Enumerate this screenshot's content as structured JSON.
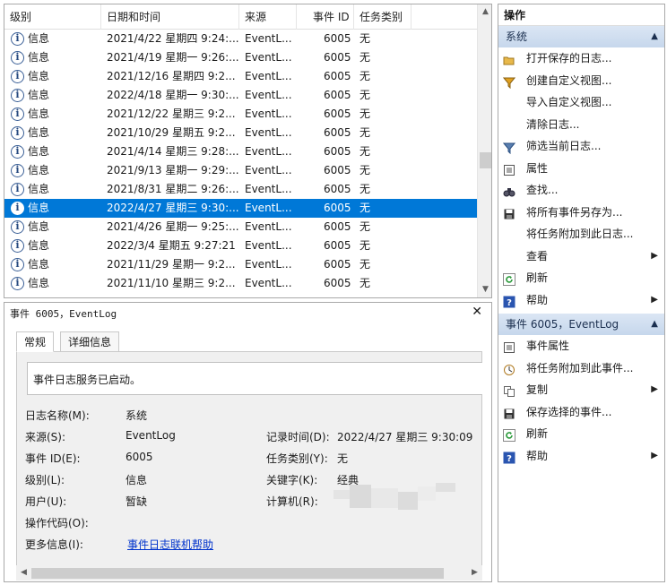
{
  "list": {
    "columns": [
      "级别",
      "日期和时间",
      "来源",
      "事件 ID",
      "任务类别"
    ],
    "rows": [
      {
        "level": "信息",
        "datetime": "2021/4/22 星期四 9:24:...",
        "source": "EventL...",
        "id": "6005",
        "task": "无"
      },
      {
        "level": "信息",
        "datetime": "2021/4/19 星期一 9:26:...",
        "source": "EventL...",
        "id": "6005",
        "task": "无"
      },
      {
        "level": "信息",
        "datetime": "2021/12/16 星期四 9:2...",
        "source": "EventL...",
        "id": "6005",
        "task": "无"
      },
      {
        "level": "信息",
        "datetime": "2022/4/18 星期一 9:30:...",
        "source": "EventL...",
        "id": "6005",
        "task": "无"
      },
      {
        "level": "信息",
        "datetime": "2021/12/22 星期三 9:2...",
        "source": "EventL...",
        "id": "6005",
        "task": "无"
      },
      {
        "level": "信息",
        "datetime": "2021/10/29 星期五 9:2...",
        "source": "EventL...",
        "id": "6005",
        "task": "无"
      },
      {
        "level": "信息",
        "datetime": "2021/4/14 星期三 9:28:...",
        "source": "EventL...",
        "id": "6005",
        "task": "无"
      },
      {
        "level": "信息",
        "datetime": "2021/9/13 星期一 9:29:...",
        "source": "EventL...",
        "id": "6005",
        "task": "无"
      },
      {
        "level": "信息",
        "datetime": "2021/8/31 星期二 9:26:...",
        "source": "EventL...",
        "id": "6005",
        "task": "无"
      },
      {
        "level": "信息",
        "datetime": "2022/4/27 星期三 9:30:...",
        "source": "EventL...",
        "id": "6005",
        "task": "无",
        "selected": true
      },
      {
        "level": "信息",
        "datetime": "2021/4/26 星期一 9:25:...",
        "source": "EventL...",
        "id": "6005",
        "task": "无"
      },
      {
        "level": "信息",
        "datetime": "2022/3/4 星期五 9:27:21",
        "source": "EventL...",
        "id": "6005",
        "task": "无"
      },
      {
        "level": "信息",
        "datetime": "2021/11/29 星期一 9:2...",
        "source": "EventL...",
        "id": "6005",
        "task": "无"
      },
      {
        "level": "信息",
        "datetime": "2021/11/10 星期三 9:2...",
        "source": "EventL...",
        "id": "6005",
        "task": "无"
      }
    ]
  },
  "detail": {
    "title": "事件 6005，EventLog",
    "tabs": [
      "常规",
      "详细信息"
    ],
    "description": "事件日志服务已启动。",
    "fields": {
      "log_name_label": "日志名称(M):",
      "log_name": "系统",
      "source_label": "来源(S):",
      "source": "EventLog",
      "event_id_label": "事件 ID(E):",
      "event_id": "6005",
      "level_label": "级别(L):",
      "level": "信息",
      "user_label": "用户(U):",
      "user": "暂缺",
      "opcode_label": "操作代码(O):",
      "more_info_label": "更多信息(I):",
      "more_info_link": "事件日志联机帮助",
      "logged_label": "记录时间(D):",
      "logged": "2022/4/27 星期三 9:30:09",
      "task_label": "任务类别(Y):",
      "task": "无",
      "keywords_label": "关键字(K):",
      "keywords": "经典",
      "computer_label": "计算机(R):"
    }
  },
  "actions": {
    "title": "操作",
    "section1": {
      "header": "系统",
      "items": [
        "打开保存的日志...",
        "创建自定义视图...",
        "导入自定义视图...",
        "清除日志...",
        "筛选当前日志...",
        "属性",
        "查找...",
        "将所有事件另存为...",
        "将任务附加到此日志...",
        "查看",
        "刷新",
        "帮助"
      ]
    },
    "section2": {
      "header": "事件 6005，EventLog",
      "items": [
        "事件属性",
        "将任务附加到此事件...",
        "复制",
        "保存选择的事件...",
        "刷新",
        "帮助"
      ]
    }
  },
  "colors": {
    "selection": "#0078d7",
    "section_header": "#c6d7ec",
    "link": "#0033cc"
  }
}
